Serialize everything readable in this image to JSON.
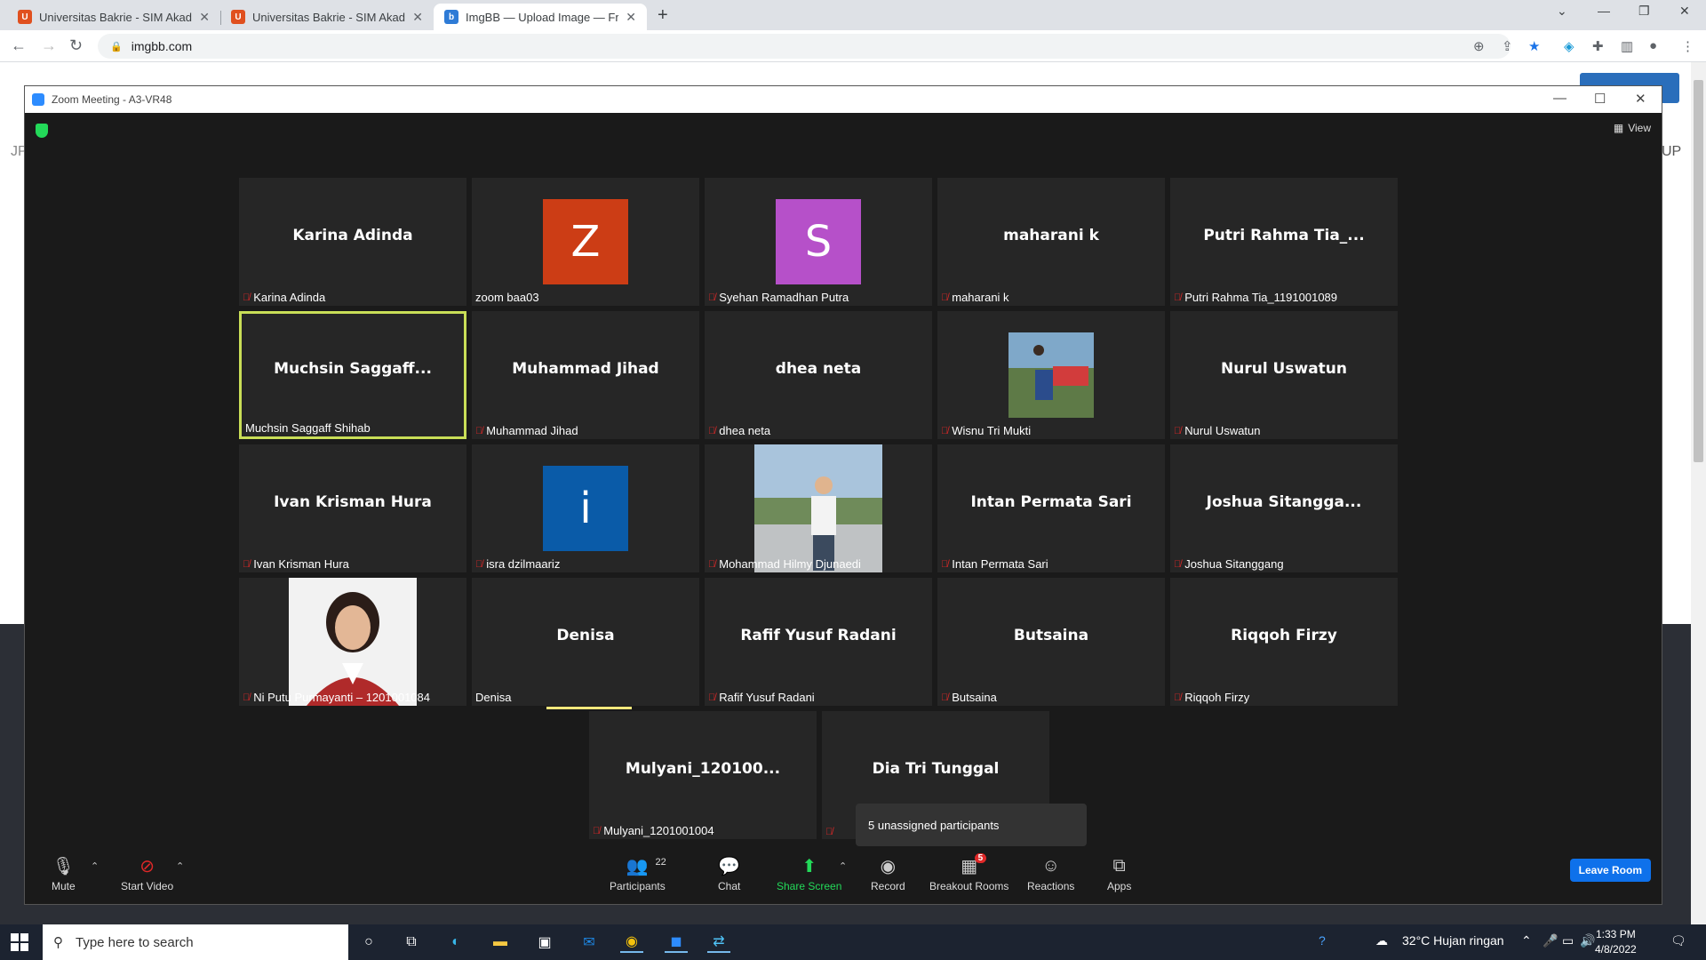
{
  "browser": {
    "tabs": [
      {
        "title": "Universitas Bakrie - SIM Akadem",
        "favicon": "orange-shield-icon"
      },
      {
        "title": "Universitas Bakrie - SIM Akadem",
        "favicon": "orange-shield-icon"
      },
      {
        "title": "ImgBB — Upload Image — Free",
        "favicon": "imgbb-icon"
      }
    ],
    "url": "imgbb.com",
    "bg_left_text": "JP",
    "bg_right_text": "UP"
  },
  "zoom": {
    "window_title": "Zoom Meeting - A3-VR48",
    "view_label": "View",
    "tiles": [
      {
        "display": "Karina Adinda",
        "label": "Karina Adinda",
        "muted": true
      },
      {
        "avatar_letter": "Z",
        "avatar_color": "#cc3d15",
        "label": "zoom baa03",
        "muted": false
      },
      {
        "avatar_letter": "S",
        "avatar_color": "#b650c9",
        "label": "Syehan Ramadhan Putra",
        "muted": true
      },
      {
        "display": "maharani k",
        "label": "maharani k",
        "muted": true
      },
      {
        "display": "Putri Rahma Tia_...",
        "label": "Putri Rahma Tia_1191001089",
        "muted": true
      },
      {
        "display": "Muchsin  Saggaff...",
        "label": "Muchsin Saggaff Shihab",
        "muted": false,
        "speaking": true
      },
      {
        "display": "Muhammad Jihad",
        "label": "Muhammad Jihad",
        "muted": true
      },
      {
        "display": "dhea neta",
        "label": "dhea neta",
        "muted": true
      },
      {
        "photo": "motorbike",
        "label": "Wisnu Tri Mukti",
        "muted": true
      },
      {
        "display": "Nurul Uswatun",
        "label": "Nurul Uswatun",
        "muted": true
      },
      {
        "display": "Ivan Krisman Hura",
        "label": "Ivan Krisman Hura",
        "muted": true
      },
      {
        "avatar_letter": "i",
        "avatar_color": "#0a5ba8",
        "label": "isra dzilmaariz",
        "muted": true
      },
      {
        "photo": "man-outdoor",
        "label": "Mohammad Hilmy Djunaedi",
        "muted": true
      },
      {
        "display": "Intan Permata Sari",
        "label": "Intan Permata Sari",
        "muted": true
      },
      {
        "display": "Joshua  Sitangga...",
        "label": "Joshua Sitanggang",
        "muted": true
      },
      {
        "photo": "woman-portrait",
        "label": "Ni Putu Purmayanti – 1201001084",
        "muted": true
      },
      {
        "display": "Denisa",
        "label": "Denisa",
        "muted": false
      },
      {
        "display": "Rafif Yusuf Radani",
        "label": "Rafif Yusuf Radani",
        "muted": true
      },
      {
        "display": "Butsaina",
        "label": "Butsaina",
        "muted": true
      },
      {
        "display": "Riqqoh Firzy",
        "label": "Riqqoh Firzy",
        "muted": true
      },
      {
        "display": "Mulyani_120100...",
        "label": "Mulyani_1201001004",
        "muted": true
      },
      {
        "display": "Dia Tri Tunggal",
        "label": "",
        "muted": true
      }
    ],
    "tooltip": "5 unassigned participants",
    "toolbar": {
      "mute": "Mute",
      "start_video": "Start Video",
      "participants": "Participants",
      "participants_count": "22",
      "chat": "Chat",
      "share_screen": "Share Screen",
      "record": "Record",
      "breakout_rooms": "Breakout Rooms",
      "breakout_badge": "5",
      "reactions": "Reactions",
      "apps": "Apps",
      "leave_room": "Leave Room"
    }
  },
  "taskbar": {
    "search_placeholder": "Type here to search",
    "weather": "32°C  Hujan ringan",
    "time": "1:33 PM",
    "date": "4/8/2022"
  }
}
